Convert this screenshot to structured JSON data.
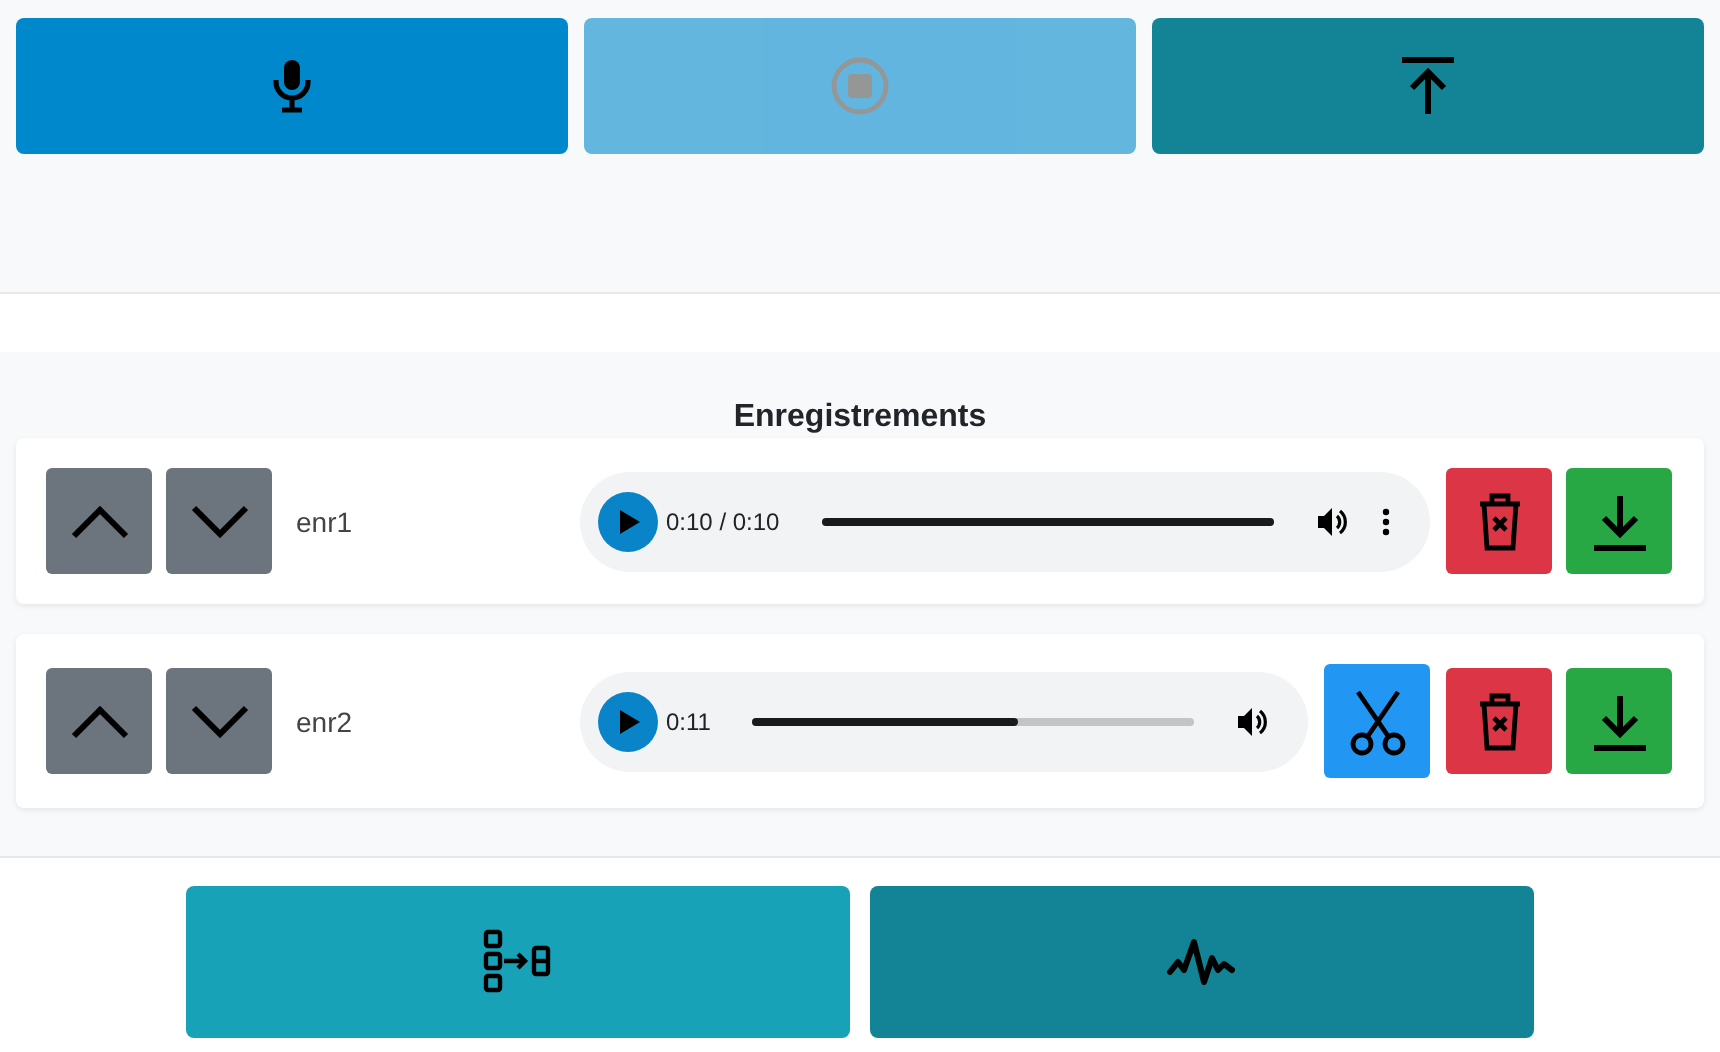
{
  "controls": [
    {
      "kind": "record",
      "disabled": false
    },
    {
      "kind": "stop",
      "disabled": true
    },
    {
      "kind": "upload",
      "disabled": false
    }
  ],
  "recordings_title": "Enregistrements",
  "recordings": [
    {
      "name": "enr1",
      "time": "0:10 / 0:10",
      "level": 1,
      "menu": true,
      "cut": false
    },
    {
      "name": "enr2",
      "time": "0:11",
      "level": 0.6,
      "menu": false,
      "cut": true
    }
  ],
  "tools": [
    {
      "kind": "split"
    },
    {
      "kind": "waveform"
    }
  ]
}
